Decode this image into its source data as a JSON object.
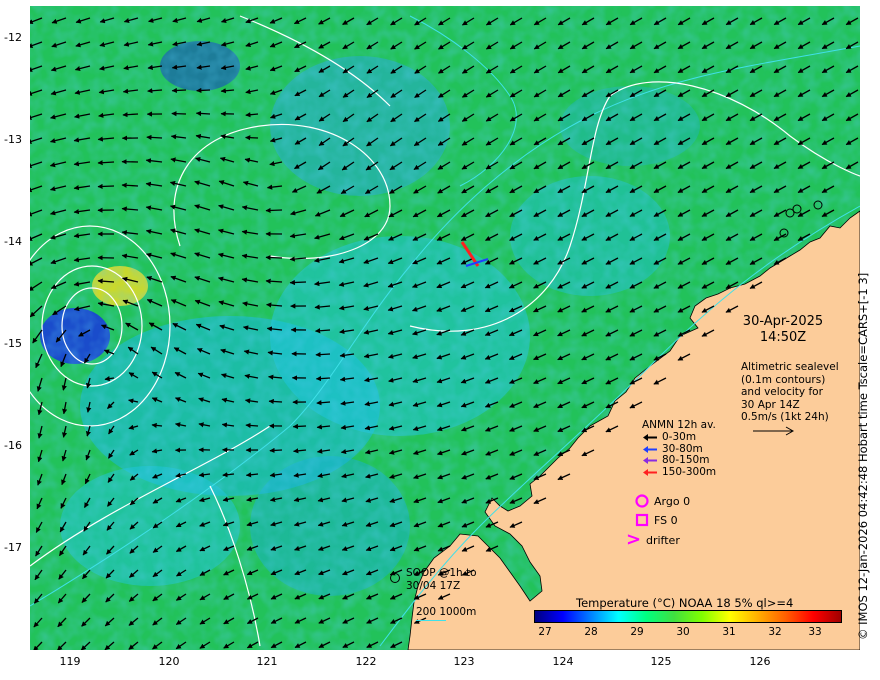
{
  "y_axis_labels": [
    "-12",
    "-13",
    "-14",
    "-15",
    "-16",
    "-17"
  ],
  "x_axis_labels": [
    "119",
    "120",
    "121",
    "122",
    "123",
    "124",
    "125",
    "126"
  ],
  "right_caption": "© IMOS 12-Jan-2026 04:42:48 Hobart time Tscale=CARS+[-1 3]",
  "date": "30-Apr-2025",
  "time": "14:50Z",
  "altimetry_note": [
    "Altimetric sealevel",
    "(0.1m contours)",
    "and velocity for",
    "30 Apr 14Z",
    "0.5m/s (1kt 24h)"
  ],
  "anmn": {
    "title": "ANMN 12h av.",
    "rows": [
      {
        "label": "0-30m",
        "color": "#000000"
      },
      {
        "label": "30-80m",
        "color": "#1f3fff"
      },
      {
        "label": "80-150m",
        "color": "#8a2be2"
      },
      {
        "label": "150-300m",
        "color": "#ff2020"
      }
    ]
  },
  "argo_label": "Argo 0",
  "fs_label": "FS 0",
  "drifter_label": "drifter",
  "drifter_symbol": ">",
  "soop_label": [
    "SOOP @1h to",
    "30/04 17Z"
  ],
  "isobath_label": "200  1000m",
  "colorbar_title": "Temperature (°C) NOAA 18 5% ql>=4",
  "colorbar_labels": [
    "27",
    "28",
    "29",
    "30",
    "31",
    "32",
    "33"
  ],
  "colors": {
    "land": "#fccc9a",
    "sea": "#22c25a",
    "magenta": "#ff00ff",
    "isobath": "#40e0e8"
  }
}
